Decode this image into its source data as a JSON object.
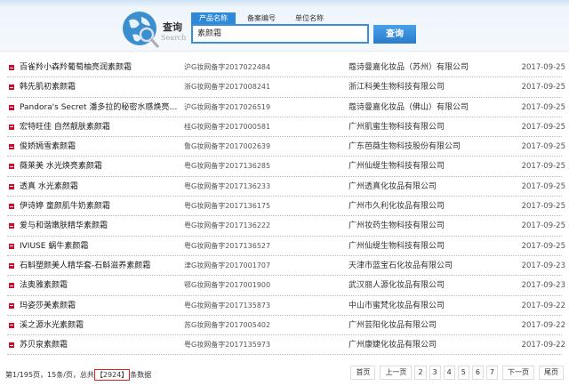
{
  "search": {
    "logo_title": "查询",
    "logo_sub": "Search",
    "tabs": [
      "产品名称",
      "备案编号",
      "单位名称"
    ],
    "active_tab": 0,
    "query": "素颜霜",
    "button": "查询"
  },
  "rows": [
    {
      "name": "百雀羚小森羚葡萄柚亮润素颜霜",
      "reg": "沪G妆网备字2017022484",
      "company": "蔻诗曼嘉化妆品（苏州）有限公司",
      "date": "2017-09-25"
    },
    {
      "name": "韩先肌初素颜霜",
      "reg": "浙G妆网备字2017008241",
      "company": "浙江科美生物科技有限公司",
      "date": "2017-09-25"
    },
    {
      "name": "Pandora's Secret 潘多拉的秘密水感焕亮…",
      "reg": "沪G妆网备字2017026519",
      "company": "蔻诗曼嘉化妆品（佛山）有限公司",
      "date": "2017-09-25"
    },
    {
      "name": "宏特旺佳 自然靓肤素颜霜",
      "reg": "桂G妆网备字2017000581",
      "company": "广州肌蜜生物科技有限公司",
      "date": "2017-09-25"
    },
    {
      "name": "俊娇嫣雪素颜霜",
      "reg": "鲁G妆网备字2017002639",
      "company": "广东芭薇生物科技股份有限公司",
      "date": "2017-09-25"
    },
    {
      "name": "薇莱美 水光焕亮素颜霜",
      "reg": "粤G妆网备字2017136285",
      "company": "广州仙缇生物科技有限公司",
      "date": "2017-09-25"
    },
    {
      "name": "透真 水光素颜霜",
      "reg": "粤G妆网备字2017136233",
      "company": "广州透真化妆品有限公司",
      "date": "2017-09-25"
    },
    {
      "name": "伊诗婷 童颜肌牛奶素颜霜",
      "reg": "粤G妆网备字2017136175",
      "company": "广州市久利化妆品有限公司",
      "date": "2017-09-25"
    },
    {
      "name": "爱与和谐嫩肤精华素颜霜",
      "reg": "粤G妆网备字2017136222",
      "company": "广州妆药生物科技有限公司",
      "date": "2017-09-25"
    },
    {
      "name": "IVIUSE 蜗牛素颜霜",
      "reg": "粤G妆网备字2017136527",
      "company": "广州仙缇生物科技有限公司",
      "date": "2017-09-25"
    },
    {
      "name": "石斛塑颜美人精华套-石斛滋养素颜霜",
      "reg": "津G妆网备字2017001707",
      "company": "天津市蓝宝石化妆品有限公司",
      "date": "2017-09-23"
    },
    {
      "name": "法奥雅素颜霜",
      "reg": "鄂G妆网备字2017001900",
      "company": "武汉丽人源化妆品有限公司",
      "date": "2017-09-23"
    },
    {
      "name": "玛姿莎美素颜霜",
      "reg": "粤G妆网备字2017135873",
      "company": "中山市蜜梵化妆品有限公司",
      "date": "2017-09-22"
    },
    {
      "name": "溪之源水光素颜霜",
      "reg": "苏G妆网备字2017005402",
      "company": "广州芸阳化妆品有限公司",
      "date": "2017-09-22"
    },
    {
      "name": "苏贝泉素颜霜",
      "reg": "粤G妆网备字2017135973",
      "company": "广州康婕化妆品有限公司",
      "date": "2017-09-22"
    }
  ],
  "footer": {
    "info_prefix": "第1/195页，15条/页，总共",
    "total": "【2924】",
    "info_suffix": "条数据",
    "pager": {
      "first": "首页",
      "prev": "上一页",
      "pages": [
        "2",
        "3",
        "4",
        "5",
        "6",
        "7"
      ],
      "next": "下一页",
      "last": "尾页"
    }
  }
}
